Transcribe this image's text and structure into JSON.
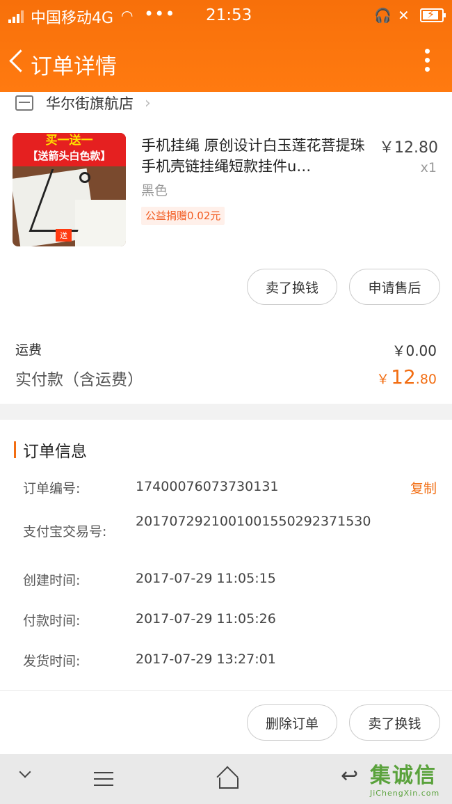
{
  "status_bar": {
    "carrier": "中国移动4G",
    "dots": "•••",
    "time": "21:53"
  },
  "header": {
    "title": "订单详情"
  },
  "store": {
    "name": "华尔街旗航店"
  },
  "product": {
    "image_banner_line1": "买一送一",
    "image_banner_line2": "【送箭头白色款】",
    "image_badge": "送",
    "name": "手机挂绳 原创设计白玉莲花菩提珠手机壳链挂绳短款挂件u…",
    "price": "￥12.80",
    "quantity": "x1",
    "sku": "黑色",
    "charity": "公益捐赠0.02元"
  },
  "item_actions": {
    "sell_label": "卖了换钱",
    "aftersale_label": "申请售后"
  },
  "summary": {
    "shipping_label": "运费",
    "shipping_value": "￥0.00",
    "paid_label": "实付款（含运费）",
    "paid_currency": "￥",
    "paid_int": "12",
    "paid_dec": ".80"
  },
  "order_info": {
    "section_title": "订单信息",
    "copy_label": "复制",
    "rows": [
      {
        "label": "订单编号:",
        "value": "17400076073730131"
      },
      {
        "label": "支付宝交易号:",
        "value": "2017072921001001550292371530"
      },
      {
        "label": "创建时间:",
        "value": "2017-07-29 11:05:15"
      },
      {
        "label": "付款时间:",
        "value": "2017-07-29 11:05:26"
      },
      {
        "label": "发货时间:",
        "value": "2017-07-29 13:27:01"
      }
    ]
  },
  "footer_actions": {
    "delete_label": "删除订单",
    "sell_label": "卖了换钱"
  },
  "watermark": {
    "chars": "集诚信",
    "sub": "JiChengXin.com"
  },
  "colors": {
    "accent": "#f26d12",
    "header": "#ff7a10"
  }
}
